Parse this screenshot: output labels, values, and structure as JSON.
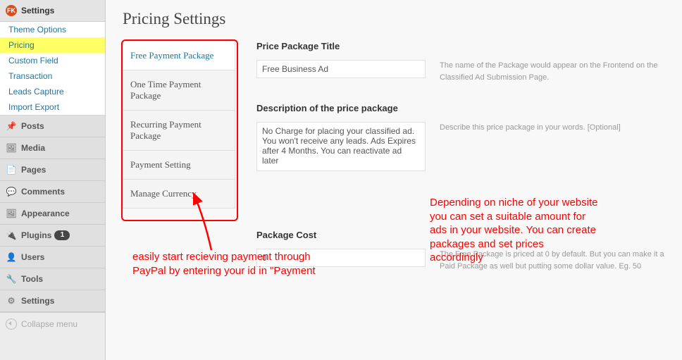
{
  "sidebar": {
    "current_section": "Settings",
    "sub_items": [
      "Theme Options",
      "Pricing",
      "Custom Field",
      "Transaction",
      "Leads Capture",
      "Import Export"
    ],
    "highlight_index": 1,
    "menu": [
      {
        "icon": "pin",
        "label": "Posts"
      },
      {
        "icon": "media",
        "label": "Media"
      },
      {
        "icon": "page",
        "label": "Pages"
      },
      {
        "icon": "comment",
        "label": "Comments"
      },
      {
        "icon": "appearance",
        "label": "Appearance"
      },
      {
        "icon": "plugin",
        "label": "Plugins",
        "badge": "1"
      },
      {
        "icon": "users",
        "label": "Users"
      },
      {
        "icon": "tools",
        "label": "Tools"
      },
      {
        "icon": "settings",
        "label": "Settings"
      }
    ],
    "collapse": "Collapse menu"
  },
  "page_title": "Pricing Settings",
  "tabs": [
    "Free Payment Package",
    "One Time Payment Package",
    "Recurring Payment Package",
    "Payment Setting",
    "Manage Currency"
  ],
  "active_tab": 0,
  "fields": {
    "title": {
      "label": "Price Package Title",
      "value": "Free Business Ad",
      "help": "The name of the Package would appear on the Frontend on the Classified Ad Submission Page."
    },
    "desc": {
      "label": "Description of the price package",
      "value": "No Charge for placing your classified ad. You won't receive any leads. Ads Expires after 4 Months. You can reactivate ad later",
      "help": "Describe this price package in your words. [Optional]"
    },
    "cost": {
      "label": "Package Cost",
      "value": "0",
      "help": "The Free Package is priced at 0 by default. But you can make it a Paid Package as well but putting some dollar value. Eg. 50"
    }
  },
  "annotations": {
    "a1": "easily start recieving payment through PayPal by entering your id in \"Payment",
    "a2": "Depending on niche of your website you can set a suitable amount for ads in your website. You can create packages and set prices accordingly"
  }
}
